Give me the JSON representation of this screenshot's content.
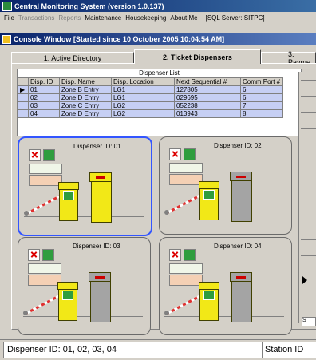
{
  "app": {
    "title": "Central Monitoring System  (version 1.0.137)"
  },
  "menu": {
    "file": "File",
    "transactions": "Transactions",
    "reports": "Reports",
    "maintenance": "Maintenance",
    "housekeeping": "Housekeeping",
    "about": "About Me",
    "server": "[SQL Server: SITPC]"
  },
  "console": {
    "title": "Console Window  [Started since 10 October 2005 10:04:54 AM]"
  },
  "tabs": [
    {
      "label": "1. Active Directory"
    },
    {
      "label": "2. Ticket Dispensers"
    },
    {
      "label": "3. Payme"
    }
  ],
  "list": {
    "caption": "Dispenser List",
    "columns": [
      "Disp. ID",
      "Disp. Name",
      "Disp. Location",
      "Next Sequential #",
      "Comm Port #"
    ],
    "rows": [
      [
        "01",
        "Zone B Entry",
        "LG1",
        "127805",
        "6"
      ],
      [
        "02",
        "Zone D Entry",
        "LG1",
        "029695",
        "6"
      ],
      [
        "03",
        "Zone C Entry",
        "LG2",
        "052238",
        "7"
      ],
      [
        "04",
        "Zone D Entry",
        "LG2",
        "013943",
        "8"
      ]
    ]
  },
  "dispensers": [
    {
      "label": "Dispenser ID: 01",
      "color": "#f2e817"
    },
    {
      "label": "Dispenser ID: 02",
      "color": "#a4a4a4"
    },
    {
      "label": "Dispenser ID: 03",
      "color": "#a4a4a4"
    },
    {
      "label": "Dispenser ID: 04",
      "color": "#a4a4a4"
    }
  ],
  "statusbar": {
    "left": "Dispenser ID: 01, 02, 03, 04",
    "right": "Station ID"
  },
  "colors": {
    "title_bar": "#0a246a",
    "row_highlight": "#c6cff4",
    "selected_border": "#3355ff",
    "active_yellow": "#f2e817"
  },
  "right_column": {
    "box_text": "S"
  }
}
